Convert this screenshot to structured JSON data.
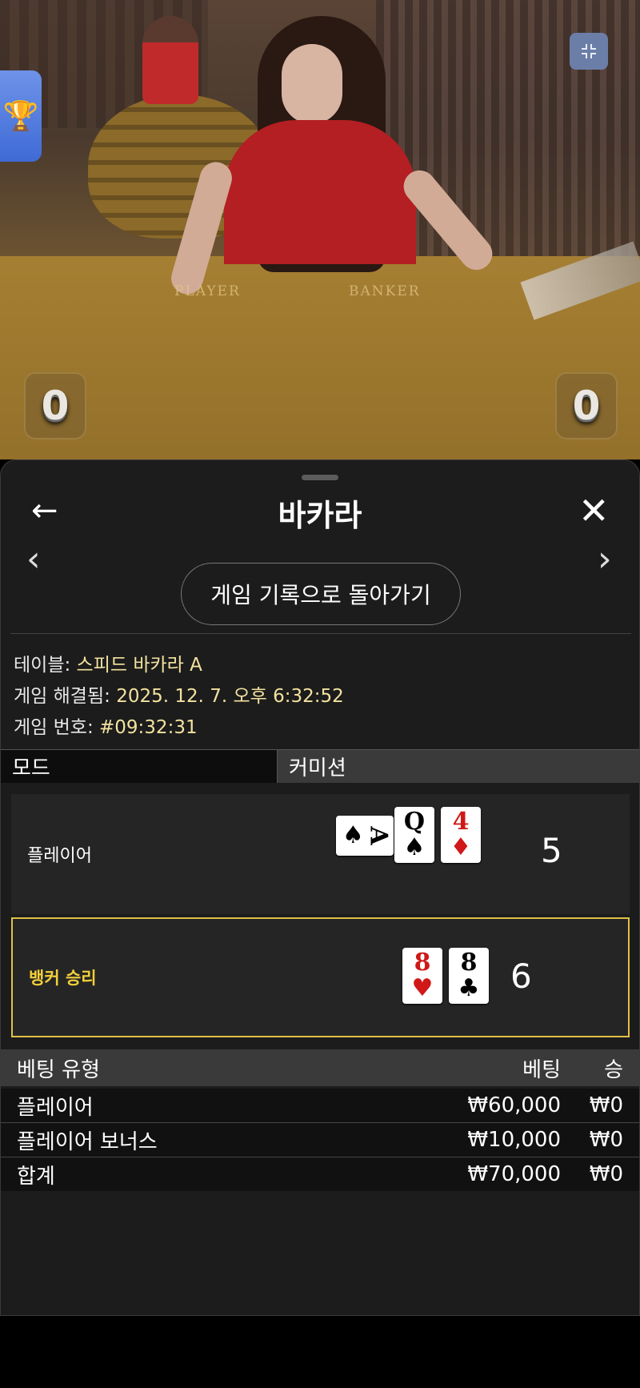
{
  "video": {
    "table_labels": {
      "player": "PLAYER",
      "banker": "BANKER"
    },
    "scores": {
      "player": "0",
      "banker": "0"
    },
    "icons": {
      "leaderboard": "trophy-icon",
      "minimize": "minimize-icon"
    }
  },
  "panel": {
    "title": "바카라",
    "back_icon": "←",
    "close_icon": "✕",
    "prev_icon": "‹",
    "next_icon": "›",
    "history_button": "게임 기록으로 돌아가기",
    "info": {
      "table_label": "테이블:",
      "table_value": "스피드 바카라 A",
      "resolved_label": "게임 해결됨:",
      "resolved_value": "2025. 12. 7. 오후 6:32:52",
      "game_no_label": "게임 번호:",
      "game_no_value": "#09:32:31"
    },
    "mode": {
      "left": "모드",
      "right": "커미션"
    },
    "player_hand": {
      "label": "플레이어",
      "total": "5",
      "cards": [
        {
          "rank": "A",
          "suit": "♠",
          "color": "black",
          "orientation": "sideways"
        },
        {
          "rank": "Q",
          "suit": "♠",
          "color": "black"
        },
        {
          "rank": "4",
          "suit": "♦",
          "color": "red"
        }
      ]
    },
    "banker_hand": {
      "label": "뱅커 승리",
      "total": "6",
      "cards": [
        {
          "rank": "8",
          "suit": "♥",
          "color": "red"
        },
        {
          "rank": "8",
          "suit": "♣",
          "color": "black"
        }
      ]
    },
    "bets": {
      "headers": {
        "type": "베팅 유형",
        "bet": "베팅",
        "win": "승"
      },
      "rows": [
        {
          "type": "플레이어",
          "bet": "₩60,000",
          "win": "₩0"
        },
        {
          "type": "플레이어 보너스",
          "bet": "₩10,000",
          "win": "₩0"
        },
        {
          "type": "합계",
          "bet": "₩70,000",
          "win": "₩0"
        }
      ]
    }
  }
}
